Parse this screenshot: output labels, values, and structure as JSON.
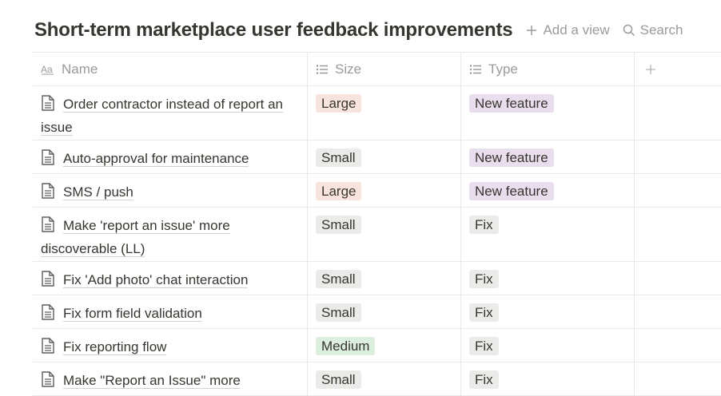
{
  "header": {
    "title": "Short-term marketplace user feedback improvements",
    "add_view_label": "Add a view",
    "search_label": "Search"
  },
  "columns": {
    "name": "Name",
    "size": "Size",
    "type": "Type"
  },
  "rows": [
    {
      "name": "Order contractor instead of report an issue",
      "size": "Large",
      "type": "New feature"
    },
    {
      "name": "Auto-approval for maintenance",
      "size": "Small",
      "type": "New feature"
    },
    {
      "name": "SMS / push",
      "size": "Large",
      "type": "New feature"
    },
    {
      "name": "Make 'report an issue' more discoverable (LL)",
      "size": "Small",
      "type": "Fix"
    },
    {
      "name": "Fix 'Add photo' chat interaction",
      "size": "Small",
      "type": "Fix"
    },
    {
      "name": "Fix form field validation",
      "size": "Small",
      "type": "Fix"
    },
    {
      "name": "Fix reporting flow",
      "size": "Medium",
      "type": "Fix"
    },
    {
      "name": "Make \"Report an Issue\" more",
      "size": "Small",
      "type": "Fix"
    }
  ],
  "colors": {
    "large": "#f8e4dd",
    "small": "#ebebea",
    "medium": "#dcefdf",
    "new_feature": "#e8deee",
    "fix": "#ebebea"
  }
}
